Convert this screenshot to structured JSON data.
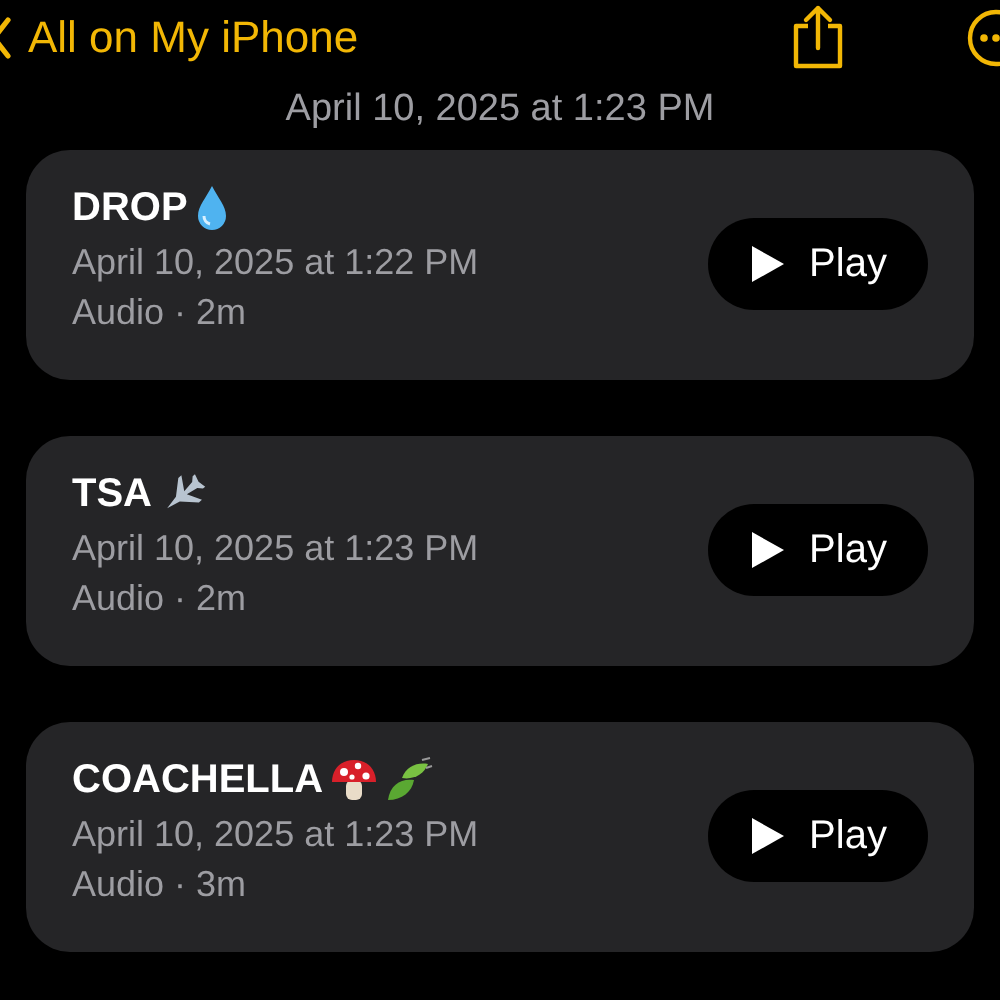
{
  "nav": {
    "back_label": "All on My iPhone"
  },
  "date_header": "April 10, 2025 at 1:23 PM",
  "recordings": [
    {
      "title": "DROP",
      "icons": [
        {
          "kind": "droplet"
        }
      ],
      "date": "April 10, 2025 at 1:22 PM",
      "meta": "Audio · 2m",
      "button": "Play"
    },
    {
      "title": "TSA",
      "icons": [
        {
          "kind": "airplane"
        }
      ],
      "date": "April 10, 2025 at 1:23 PM",
      "meta": "Audio · 2m",
      "button": "Play"
    },
    {
      "title": "COACHELLA",
      "icons": [
        {
          "kind": "mushroom"
        },
        {
          "kind": "leaves"
        }
      ],
      "date": "April 10, 2025 at 1:23 PM",
      "meta": "Audio · 3m",
      "button": "Play"
    }
  ]
}
